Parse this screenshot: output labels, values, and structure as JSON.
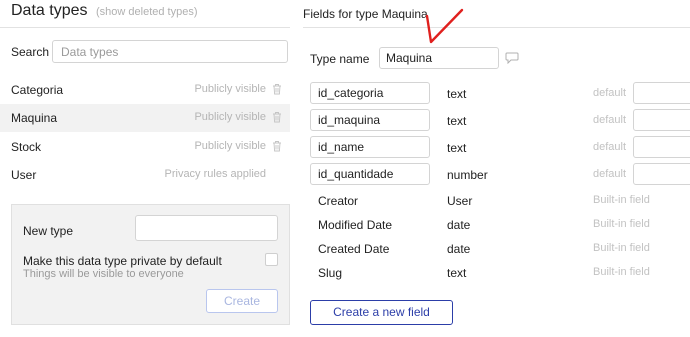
{
  "left": {
    "title": "Data types",
    "show_deleted": "(show deleted types)",
    "search_label": "Search",
    "search_placeholder": "Data types",
    "types": [
      {
        "name": "Categoria",
        "visibility": "Publicly visible",
        "trash": true,
        "selected": false
      },
      {
        "name": "Maquina",
        "visibility": "Publicly visible",
        "trash": true,
        "selected": true
      },
      {
        "name": "Stock",
        "visibility": "Publicly visible",
        "trash": true,
        "selected": false
      },
      {
        "name": "User",
        "visibility": "Privacy rules applied",
        "trash": false,
        "selected": false
      }
    ],
    "new_type": {
      "label": "New type",
      "value": "",
      "private_label": "Make this data type private by default",
      "private_sub": "Things will be visible to everyone",
      "create_label": "Create"
    }
  },
  "right": {
    "title": "Fields for type Maquina",
    "type_name_label": "Type name",
    "type_name_value": "Maquina",
    "fields": [
      {
        "name": "id_categoria",
        "type": "text",
        "default": "default"
      },
      {
        "name": "id_maquina",
        "type": "text",
        "default": "default"
      },
      {
        "name": "id_name",
        "type": "text",
        "default": "default"
      },
      {
        "name": "id_quantidade",
        "type": "number",
        "default": "default"
      }
    ],
    "builtin_fields": [
      {
        "name": "Creator",
        "type": "User",
        "note": "Built-in field"
      },
      {
        "name": "Modified Date",
        "type": "date",
        "note": "Built-in field"
      },
      {
        "name": "Created Date",
        "type": "date",
        "note": "Built-in field"
      },
      {
        "name": "Slug",
        "type": "text",
        "note": "Built-in field"
      }
    ],
    "create_field_label": "Create a new field"
  },
  "icons": {
    "trash": "trash-icon",
    "comment": "comment-icon",
    "annotation": "red-check-annotation"
  },
  "colors": {
    "accent": "#2c3ea8",
    "annotation": "#e0201e",
    "selected_row": "#f2f2f2"
  }
}
